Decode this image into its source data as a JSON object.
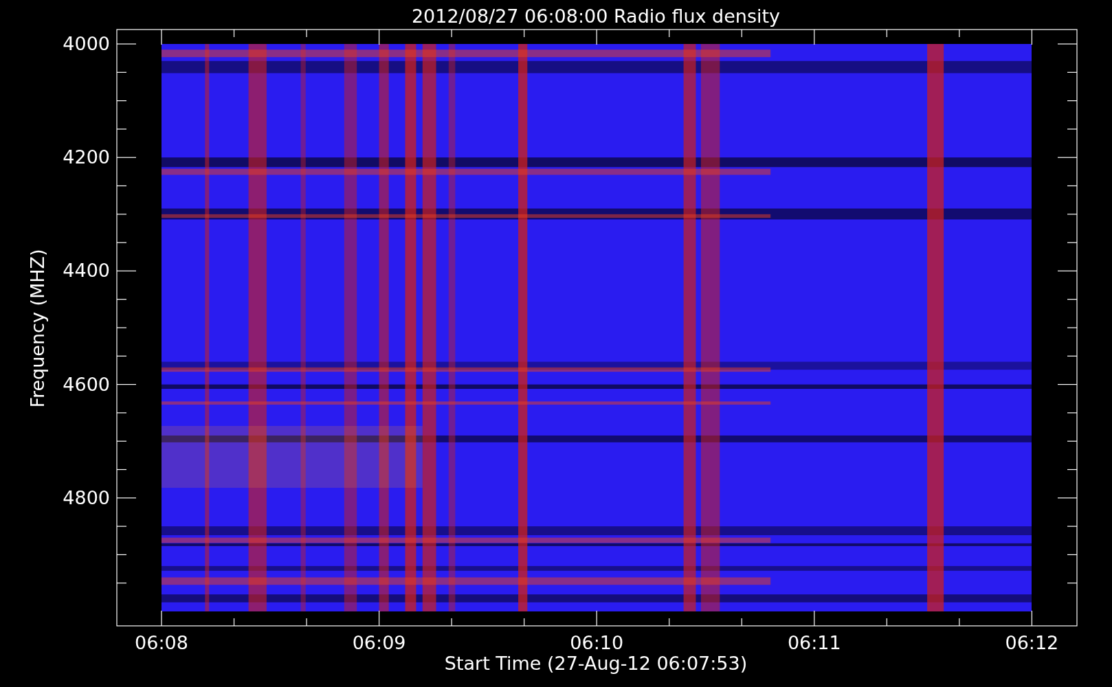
{
  "title": "2012/08/27 06:08:00 Radio flux density",
  "x_axis": {
    "label": "Start Time (27-Aug-12 06:07:53)",
    "ticks": [
      "06:08",
      "06:09",
      "06:10",
      "06:11",
      "06:12"
    ]
  },
  "y_axis": {
    "label": "Frequency (MHZ)",
    "ticks": [
      "4000",
      "4200",
      "4400",
      "4600",
      "4800"
    ]
  }
}
